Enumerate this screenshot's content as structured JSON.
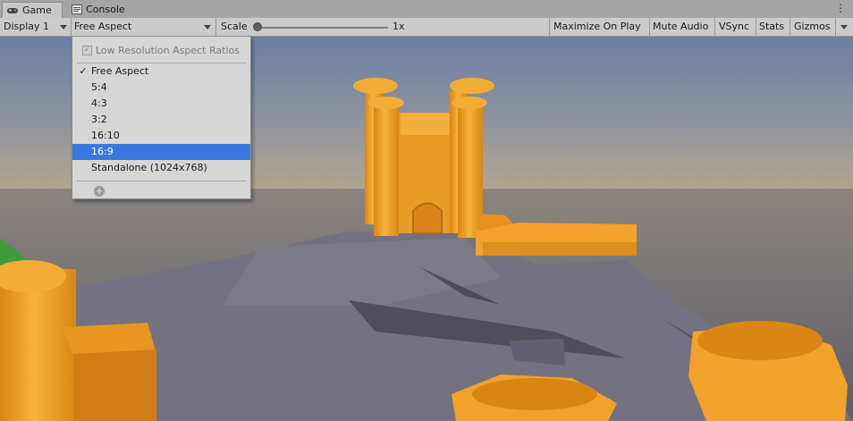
{
  "tabs": [
    {
      "label": "Game",
      "icon": "gamepad-icon"
    },
    {
      "label": "Console",
      "icon": "console-icon"
    }
  ],
  "toolbar": {
    "display": "Display 1",
    "aspect": "Free Aspect",
    "scale_label": "Scale",
    "scale_value": "1x",
    "maximize": "Maximize On Play",
    "mute": "Mute Audio",
    "vsync": "VSync",
    "stats": "Stats",
    "gizmos": "Gizmos"
  },
  "aspect_menu": {
    "low_res_label": "Low Resolution Aspect Ratios",
    "low_res_checked": true,
    "items": [
      {
        "label": "Free Aspect",
        "checked": true
      },
      {
        "label": "5:4"
      },
      {
        "label": "4:3"
      },
      {
        "label": "3:2"
      },
      {
        "label": "16:10"
      },
      {
        "label": "16:9",
        "highlighted": true
      },
      {
        "label": "Standalone (1024x768)"
      }
    ],
    "check_glyph": "✓",
    "add_glyph": "+"
  },
  "colors": {
    "sky_top": "#6f7fa0",
    "horizon": "#a69d90",
    "ground": "#6f6d76",
    "castle": "#f0a22a",
    "highlight": "#3a78e0"
  }
}
